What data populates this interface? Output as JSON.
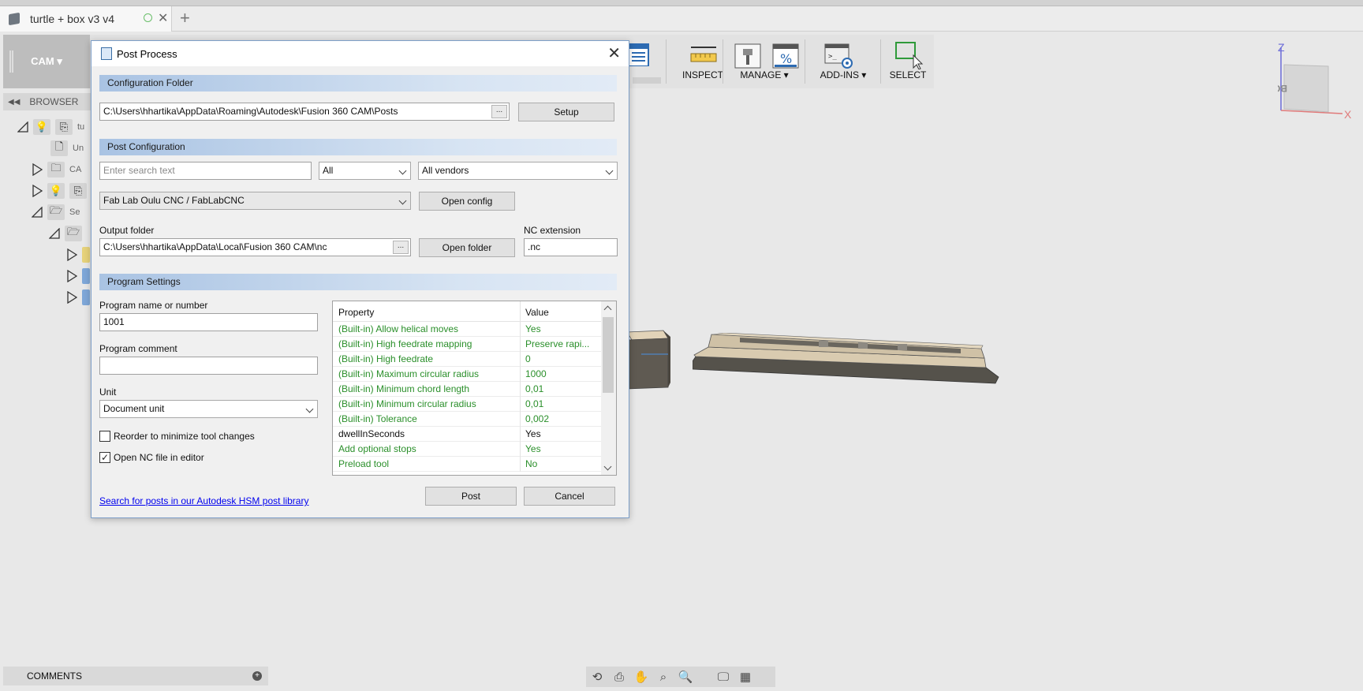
{
  "document_tab": {
    "title": "turtle + box v3 v4"
  },
  "toolbar": {
    "workspace": "CAM ▾",
    "groups": [
      {
        "label": "INSPECT"
      },
      {
        "label": "MANAGE ▾"
      },
      {
        "label": "ADD-INS ▾"
      },
      {
        "label": "SELECT"
      }
    ]
  },
  "browser": {
    "header": "BROWSER",
    "rows": [
      {
        "text": "tu"
      },
      {
        "text": "Un"
      },
      {
        "text": "CA"
      },
      {
        "text": ""
      },
      {
        "text": "Se"
      }
    ]
  },
  "comments": {
    "label": "COMMENTS"
  },
  "viewcube": {
    "face_label": "BOTTOM",
    "axis_z": "Z",
    "axis_x": "X"
  },
  "dialog": {
    "title": "Post Process",
    "config_folder": {
      "header": "Configuration Folder",
      "path": "C:\\Users\\hhartika\\AppData\\Roaming\\Autodesk\\Fusion 360 CAM\\Posts",
      "browse": "...",
      "setup_button": "Setup"
    },
    "post_config": {
      "header": "Post Configuration",
      "search_placeholder": "Enter search text",
      "filter_selected": "All",
      "vendor_selected": "All vendors",
      "post_selected": "Fab Lab Oulu CNC / FabLabCNC",
      "open_config_button": "Open config",
      "output_folder_label": "Output folder",
      "output_folder": "C:\\Users\\hhartika\\AppData\\Local\\Fusion 360 CAM\\nc",
      "browse": "...",
      "open_folder_button": "Open folder",
      "nc_extension_label": "NC extension",
      "nc_extension": ".nc"
    },
    "program_settings": {
      "header": "Program Settings",
      "program_name_label": "Program name or number",
      "program_name": "1001",
      "program_comment_label": "Program comment",
      "program_comment": "",
      "unit_label": "Unit",
      "unit_selected": "Document unit",
      "reorder_label": "Reorder to minimize tool changes",
      "reorder_checked": false,
      "open_nc_label": "Open NC file in editor",
      "open_nc_checked": true,
      "table": {
        "col_property": "Property",
        "col_value": "Value",
        "rows": [
          {
            "property": "(Built-in) Allow helical moves",
            "value": "Yes",
            "color": "green"
          },
          {
            "property": "(Built-in) High feedrate mapping",
            "value": "Preserve rapi...",
            "color": "green"
          },
          {
            "property": "(Built-in) High feedrate",
            "value": "0",
            "color": "green"
          },
          {
            "property": "(Built-in) Maximum circular radius",
            "value": "1000",
            "color": "green"
          },
          {
            "property": "(Built-in) Minimum chord length",
            "value": "0,01",
            "color": "green"
          },
          {
            "property": "(Built-in) Minimum circular radius",
            "value": "0,01",
            "color": "green"
          },
          {
            "property": "(Built-in) Tolerance",
            "value": "0,002",
            "color": "green"
          },
          {
            "property": "dwellInSeconds",
            "value": "Yes",
            "color": "black"
          },
          {
            "property": "Add optional stops",
            "value": "Yes",
            "color": "green"
          },
          {
            "property": "Preload tool",
            "value": "No",
            "color": "green"
          }
        ]
      }
    },
    "footer": {
      "link": "Search for posts in our Autodesk HSM post library",
      "post_button": "Post",
      "cancel_button": "Cancel"
    }
  }
}
